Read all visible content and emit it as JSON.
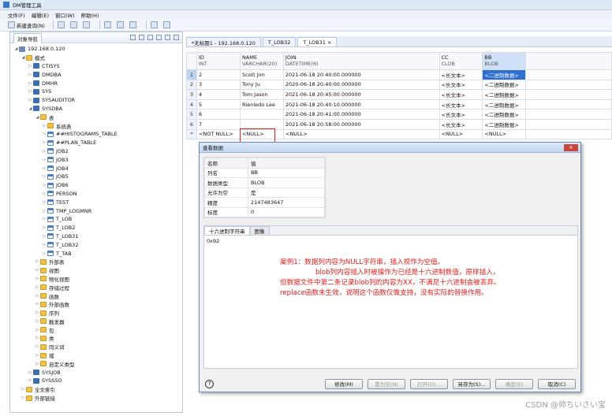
{
  "app": {
    "title": "DM管理工具"
  },
  "menu": [
    "文件(F)",
    "编辑(E)",
    "窗口(W)",
    "帮助(H)"
  ],
  "toolbar": {
    "new_query": "新建查询(N)"
  },
  "left_panel": {
    "tab": "对象导航",
    "tree": [
      {
        "label": "192.168.0.120",
        "level": 0,
        "icon": "server-icon",
        "expanded": true
      },
      {
        "label": "模式",
        "level": 1,
        "icon": "folder-icon",
        "expanded": true
      },
      {
        "label": "CTISYS",
        "level": 2,
        "icon": "schema-icon"
      },
      {
        "label": "DMDBA",
        "level": 2,
        "icon": "schema-icon"
      },
      {
        "label": "DMHR",
        "level": 2,
        "icon": "schema-icon"
      },
      {
        "label": "SYS",
        "level": 2,
        "icon": "schema-icon"
      },
      {
        "label": "SYSAUDITOR",
        "level": 2,
        "icon": "schema-icon"
      },
      {
        "label": "SYSDBA",
        "level": 2,
        "icon": "schema-icon",
        "expanded": true
      },
      {
        "label": "表",
        "level": 3,
        "icon": "folder-icon",
        "expanded": true
      },
      {
        "label": "系统表",
        "level": 4,
        "icon": "folder-icon"
      },
      {
        "label": "##HISTOGRAMS_TABLE",
        "level": 4,
        "icon": "table-icon"
      },
      {
        "label": "##PLAN_TABLE",
        "level": 4,
        "icon": "table-icon"
      },
      {
        "label": "JOB2",
        "level": 4,
        "icon": "table-icon"
      },
      {
        "label": "JOB3",
        "level": 4,
        "icon": "table-icon"
      },
      {
        "label": "JOB4",
        "level": 4,
        "icon": "table-icon"
      },
      {
        "label": "JOB5",
        "level": 4,
        "icon": "table-icon"
      },
      {
        "label": "JOB6",
        "level": 4,
        "icon": "table-icon"
      },
      {
        "label": "PERSON",
        "level": 4,
        "icon": "table-icon"
      },
      {
        "label": "TEST",
        "level": 4,
        "icon": "table-icon"
      },
      {
        "label": "TMP_LOGMNR",
        "level": 4,
        "icon": "table-icon"
      },
      {
        "label": "T_LOB",
        "level": 4,
        "icon": "table-icon"
      },
      {
        "label": "T_LOB2",
        "level": 4,
        "icon": "table-icon"
      },
      {
        "label": "T_LOB31",
        "level": 4,
        "icon": "table-icon"
      },
      {
        "label": "T_LOB32",
        "level": 4,
        "icon": "table-icon"
      },
      {
        "label": "T_TAB",
        "level": 4,
        "icon": "table-icon"
      },
      {
        "label": "外部表",
        "level": 3,
        "icon": "folder-icon"
      },
      {
        "label": "视图",
        "level": 3,
        "icon": "folder-icon"
      },
      {
        "label": "物化视图",
        "level": 3,
        "icon": "folder-icon"
      },
      {
        "label": "存储过程",
        "level": 3,
        "icon": "folder-icon"
      },
      {
        "label": "函数",
        "level": 3,
        "icon": "folder-icon"
      },
      {
        "label": "外部函数",
        "level": 3,
        "icon": "folder-icon"
      },
      {
        "label": "序列",
        "level": 3,
        "icon": "folder-icon"
      },
      {
        "label": "触发器",
        "level": 3,
        "icon": "folder-icon"
      },
      {
        "label": "包",
        "level": 3,
        "icon": "folder-icon"
      },
      {
        "label": "类",
        "level": 3,
        "icon": "folder-icon"
      },
      {
        "label": "同义词",
        "level": 3,
        "icon": "folder-icon"
      },
      {
        "label": "域",
        "level": 3,
        "icon": "folder-icon"
      },
      {
        "label": "自定义类型",
        "level": 3,
        "icon": "folder-icon"
      },
      {
        "label": "SYSJOB",
        "level": 2,
        "icon": "schema-icon"
      },
      {
        "label": "SYSSSO",
        "level": 2,
        "icon": "schema-icon"
      },
      {
        "label": "全文索引",
        "level": 1,
        "icon": "folder-icon"
      },
      {
        "label": "外部链接",
        "level": 1,
        "icon": "folder-icon"
      }
    ]
  },
  "editor_tabs": [
    {
      "label": "*无标题1 - 192.168.0.120",
      "active": false
    },
    {
      "label": "T_LOB32",
      "active": false
    },
    {
      "label": "T_LOB31",
      "active": true
    }
  ],
  "grid": {
    "columns": [
      {
        "name": "ID",
        "type": "INT"
      },
      {
        "name": "NAME",
        "type": "VARCHAR(20)"
      },
      {
        "name": "JOIN",
        "type": "DATETIME(6)"
      },
      {
        "name": "CC",
        "type": "CLOB"
      },
      {
        "name": "BB",
        "type": "BLOB"
      }
    ],
    "rows": [
      {
        "rn": "1",
        "id": "2",
        "name": "Scott Jim",
        "join": "2021-06-18 20:40:00.000000",
        "cc": "<长文本>",
        "bb": "<二进制数据>"
      },
      {
        "rn": "2",
        "id": "3",
        "name": "Tony Ju",
        "join": "2020-06-18 20:40:00.000000",
        "cc": "<长文本>",
        "bb": "<二进制数据>"
      },
      {
        "rn": "3",
        "id": "4",
        "name": "Tom Jason",
        "join": "2021-06-18 20:45:00.000000",
        "cc": "<长文本>",
        "bb": "<二进制数据>"
      },
      {
        "rn": "4",
        "id": "5",
        "name": "Rienledo Lee",
        "join": "2021-06-18 20:40:10.000000",
        "cc": "<长文本>",
        "bb": "<二进制数据>"
      },
      {
        "rn": "5",
        "id": "6",
        "name": "",
        "join": "2021-06-18 20:41:00.000000",
        "cc": "<长文本>",
        "bb": "<二进制数据>"
      },
      {
        "rn": "6",
        "id": "7",
        "name": "",
        "join": "2021-06-18 20:58:00.000000",
        "cc": "<长文本>",
        "bb": "<二进制数据>"
      },
      {
        "rn": "*",
        "id": "<NOT NULL>",
        "name": "<NULL>",
        "join": "<NULL>",
        "cc": "<NULL>",
        "bb": "<NULL>"
      }
    ]
  },
  "dialog": {
    "title": "查看数据",
    "props_header": {
      "k": "名称",
      "v": "值"
    },
    "props": [
      {
        "k": "列名",
        "v": "BB"
      },
      {
        "k": "数据类型",
        "v": "BLOB"
      },
      {
        "k": "允许为空",
        "v": "是"
      },
      {
        "k": "精度",
        "v": "2147483647"
      },
      {
        "k": "标度",
        "v": "0"
      }
    ],
    "tabs": [
      "十六进制字符串",
      "图像"
    ],
    "hex_value": "0x92",
    "note": [
      "案例1：数据列内容为NULL字符串，插入视作为空值。",
      "blob列内容插入时被操作为已经是十六进制数值，原样插入，",
      "但数据文件中第二条记录blob列的内容为XX，不满足十六进制会被丢弃。",
      "replace函数未生效，说明这个函数仅做支持，没有实际的替换作用。"
    ],
    "buttons": {
      "edit": "修改(M)",
      "set_null": "置为空(N)",
      "open": "打开(O)...",
      "save_as": "另存为(S)...",
      "ok": "确定(E)",
      "cancel": "取消(C)"
    }
  },
  "watermark": "CSDN @帅ちいさい宝"
}
